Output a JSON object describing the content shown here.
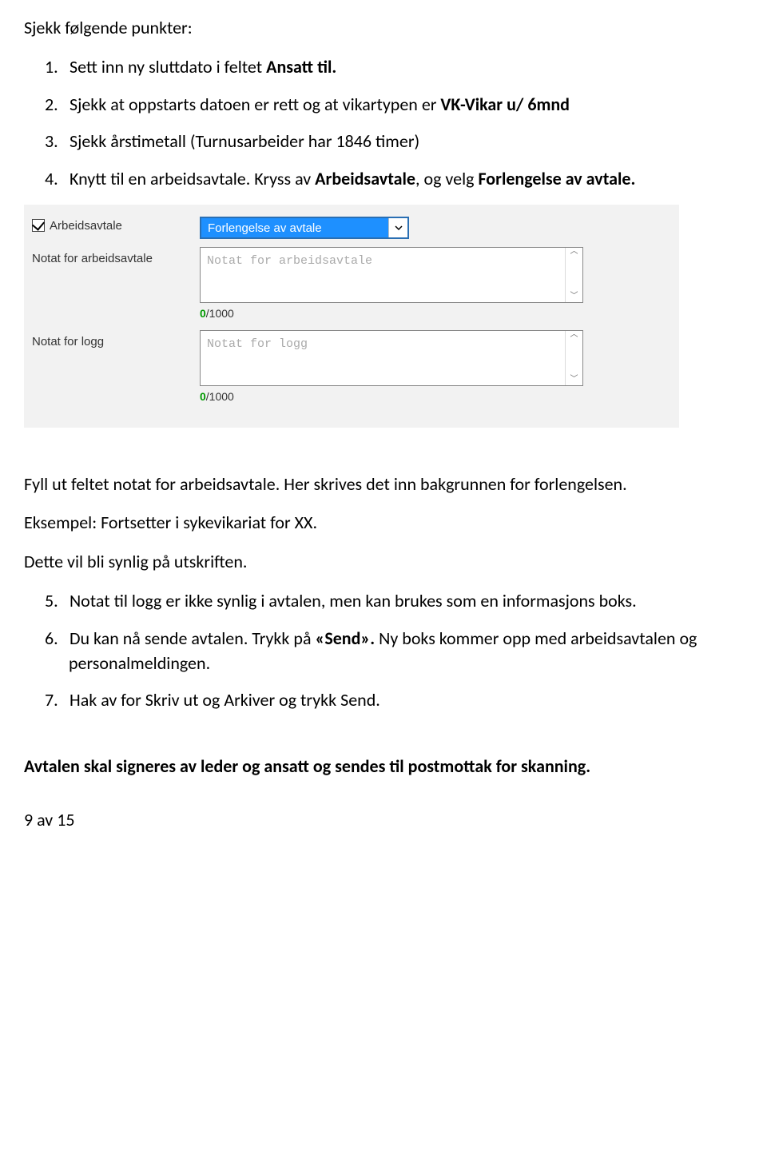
{
  "intro": "Sjekk følgende punkter:",
  "items": {
    "i1_num": "1.",
    "i1_a": "Sett inn ny sluttdato i feltet ",
    "i1_b": "Ansatt til.",
    "i2_num": "2.",
    "i2_a": "Sjekk at oppstarts datoen er rett og at vikartypen er ",
    "i2_b": "VK-Vikar u/ 6mnd",
    "i3_num": "3.",
    "i3": "Sjekk årstimetall (Turnusarbeider har 1846 timer)",
    "i4_num": "4.",
    "i4_a": "Knytt til en arbeidsavtale. Kryss av ",
    "i4_b": "Arbeidsavtale",
    "i4_c": ", og velg ",
    "i4_d": "Forlengelse av avtale.",
    "i5_num": "5.",
    "i5": "Notat til logg er ikke synlig i avtalen, men kan brukes som en informasjons boks.",
    "i6_num": "6.",
    "i6_a": "Du kan nå sende avtalen. Trykk på ",
    "i6_b": "«Send».",
    "i6_c": " Ny boks kommer opp med arbeidsavtalen og personalmeldingen.",
    "i7_num": "7.",
    "i7": "Hak av for Skriv ut og Arkiver og trykk Send."
  },
  "mid": {
    "p1": "Fyll ut feltet notat for arbeidsavtale. Her skrives det inn bakgrunnen for forlengelsen.",
    "p2": "Eksempel: Fortsetter i sykevikariat for XX.",
    "p3": "Dette vil bli synlig på utskriften."
  },
  "form": {
    "chk_label": "Arbeidsavtale",
    "select_value": "Forlengelse av avtale",
    "notat_avtale_label": "Notat for arbeidsavtale",
    "notat_avtale_ph": "Notat for arbeidsavtale",
    "notat_logg_label": "Notat for logg",
    "notat_logg_ph": "Notat for logg",
    "count_zero": "0",
    "count_rest": "/1000"
  },
  "closing_bold": "Avtalen skal signeres av leder og ansatt og sendes til postmottak for skanning.",
  "footer": "9 av 15"
}
